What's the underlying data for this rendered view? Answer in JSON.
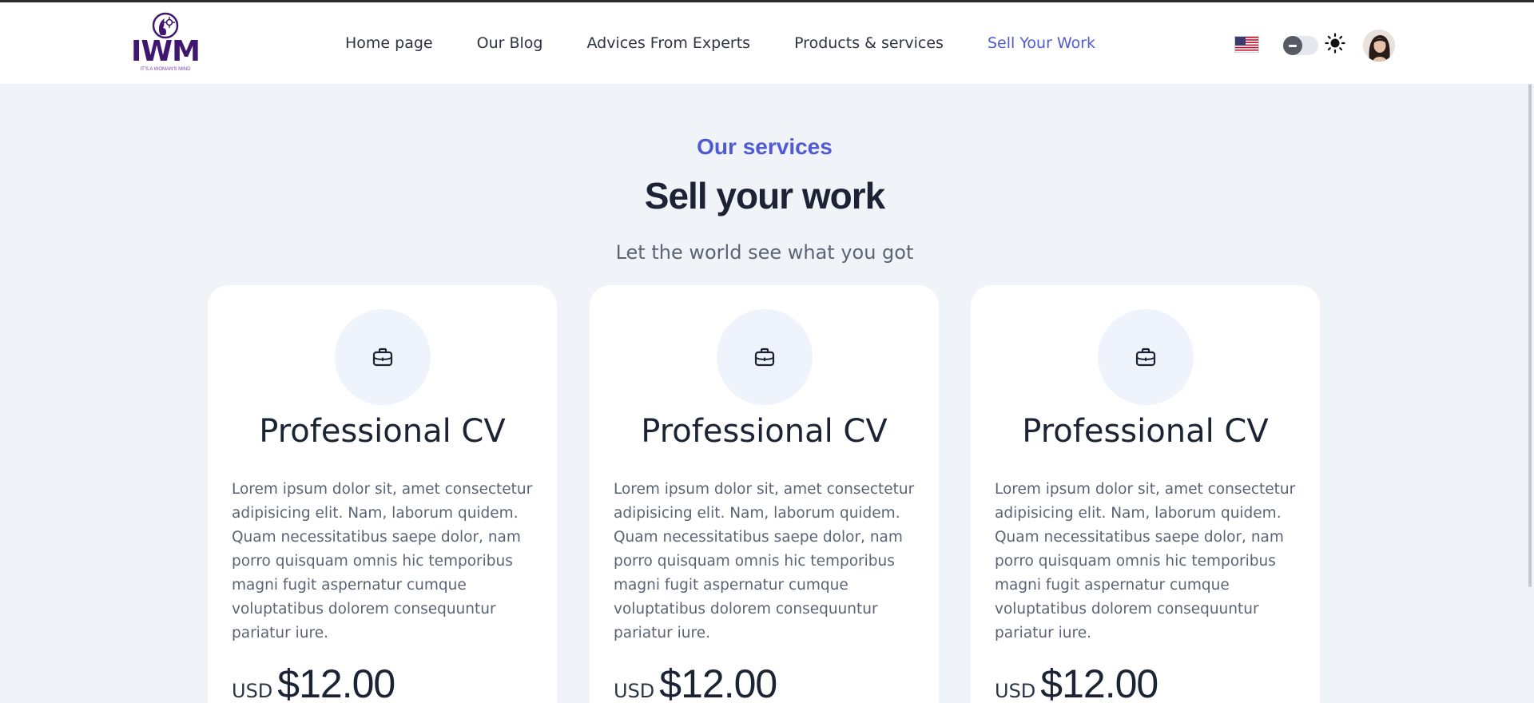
{
  "brand": {
    "logo_text": "IWM",
    "logo_tagline": "IT'S A WOMAN'S MIND"
  },
  "nav": {
    "items": [
      {
        "label": "Home page",
        "active": false
      },
      {
        "label": "Our Blog",
        "active": false
      },
      {
        "label": "Advices From Experts",
        "active": false
      },
      {
        "label": "Products & services",
        "active": false
      },
      {
        "label": "Sell Your Work",
        "active": true
      }
    ]
  },
  "header_controls": {
    "language_icon": "us-flag-icon",
    "theme_toggle_icon": "theme-toggle",
    "theme_icon": "sun-icon",
    "avatar_icon": "user-avatar"
  },
  "hero": {
    "eyebrow": "Our services",
    "title": "Sell your work",
    "subtitle": "Let the world see what you got"
  },
  "cards": [
    {
      "icon": "briefcase-icon",
      "title": "Professional CV",
      "description": "Lorem ipsum dolor sit, amet consectetur adipisicing elit. Nam, laborum quidem. Quam necessitatibus saepe dolor, nam porro quisquam omnis hic temporibus magni fugit aspernatur cumque voluptatibus dolorem consequuntur pariatur iure.",
      "currency": "USD",
      "price": "$12.00"
    },
    {
      "icon": "briefcase-icon",
      "title": "Professional CV",
      "description": "Lorem ipsum dolor sit, amet consectetur adipisicing elit. Nam, laborum quidem. Quam necessitatibus saepe dolor, nam porro quisquam omnis hic temporibus magni fugit aspernatur cumque voluptatibus dolorem consequuntur pariatur iure.",
      "currency": "USD",
      "price": "$12.00"
    },
    {
      "icon": "briefcase-icon",
      "title": "Professional CV",
      "description": "Lorem ipsum dolor sit, amet consectetur adipisicing elit. Nam, laborum quidem. Quam necessitatibus saepe dolor, nam porro quisquam omnis hic temporibus magni fugit aspernatur cumque voluptatibus dolorem consequuntur pariatur iure.",
      "currency": "USD",
      "price": "$12.00"
    }
  ],
  "colors": {
    "accent": "#4f5bd5",
    "brand": "#3f1670",
    "page_background": "#f0f3f8",
    "heading": "#1c2335",
    "body_text": "#5b6475"
  }
}
